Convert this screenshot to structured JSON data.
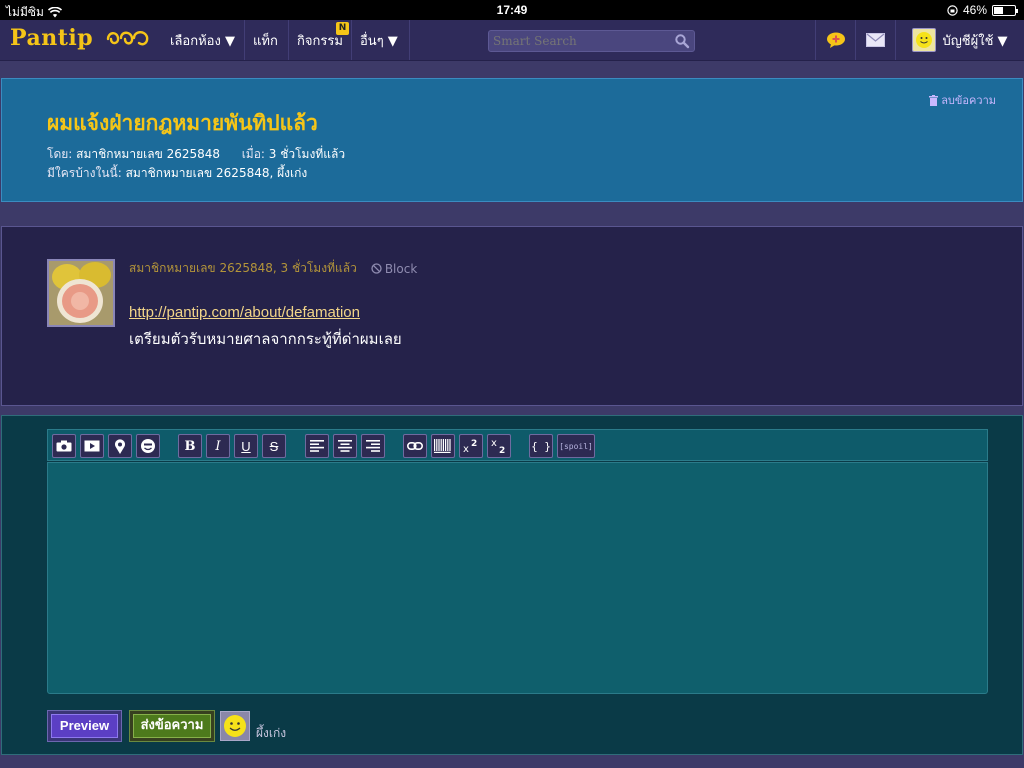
{
  "status_bar": {
    "carrier": "ไม่มีซิม",
    "time": "17:49",
    "battery_text": "46%",
    "battery_level": 0.46
  },
  "nav": {
    "logo": "Pantip",
    "items": [
      {
        "label": "เลือกห้อง ▼"
      },
      {
        "label": "แท็ก"
      },
      {
        "label": "กิจกรรม",
        "badge": "N"
      },
      {
        "label": "อื่นๆ ▼"
      }
    ],
    "search_placeholder": "Smart Search",
    "account_label": "บัญชีผู้ใช้ ▼"
  },
  "topic": {
    "title": "ผมแจ้งฝ่ายกฎหมายพันทิปแล้ว",
    "delete_label": "ลบข้อความ",
    "by_label": "โดย:",
    "author": "สมาชิกหมายเลข 2625848",
    "when_label": "เมื่อ:",
    "when": "3 ชั่วโมงที่แล้ว",
    "present_label": "มีใครบ้างในนี้:",
    "present": "สมาชิกหมายเลข 2625848, ผึ้งเก่ง"
  },
  "comment": {
    "author_time": "สมาชิกหมายเลข 2625848, 3 ชั่วโมงที่แล้ว",
    "block_label": "Block",
    "link": "http://pantip.com/about/defamation",
    "text": "เตรียมตัวรับหมายศาลจากกระทู้ที่ด่าผมเลย"
  },
  "editor": {
    "toolbar_buttons": [
      {
        "name": "camera-icon"
      },
      {
        "name": "video-icon"
      },
      {
        "name": "map-pin-icon"
      },
      {
        "name": "emoticon-icon"
      },
      {
        "name": "bold-icon",
        "text": "B"
      },
      {
        "name": "italic-icon",
        "text": "I"
      },
      {
        "name": "underline-icon",
        "text": "U"
      },
      {
        "name": "strike-icon",
        "text": "S"
      },
      {
        "name": "align-left-icon"
      },
      {
        "name": "align-center-icon"
      },
      {
        "name": "align-right-icon"
      },
      {
        "name": "link-icon"
      },
      {
        "name": "barcode-icon"
      },
      {
        "name": "superscript-icon"
      },
      {
        "name": "subscript-icon"
      },
      {
        "name": "code-icon",
        "text": "{ }"
      },
      {
        "name": "spoil-icon",
        "text": "[spoil]"
      }
    ],
    "preview_label": "Preview",
    "send_label": "ส่งข้อความ",
    "username": "ผึ้งเก่ง"
  },
  "colors": {
    "accent_yellow": "#f5c518",
    "navbar": "#2f2b5a",
    "title_panel": "#1c6b9a",
    "editor": "#0f5f6c"
  }
}
